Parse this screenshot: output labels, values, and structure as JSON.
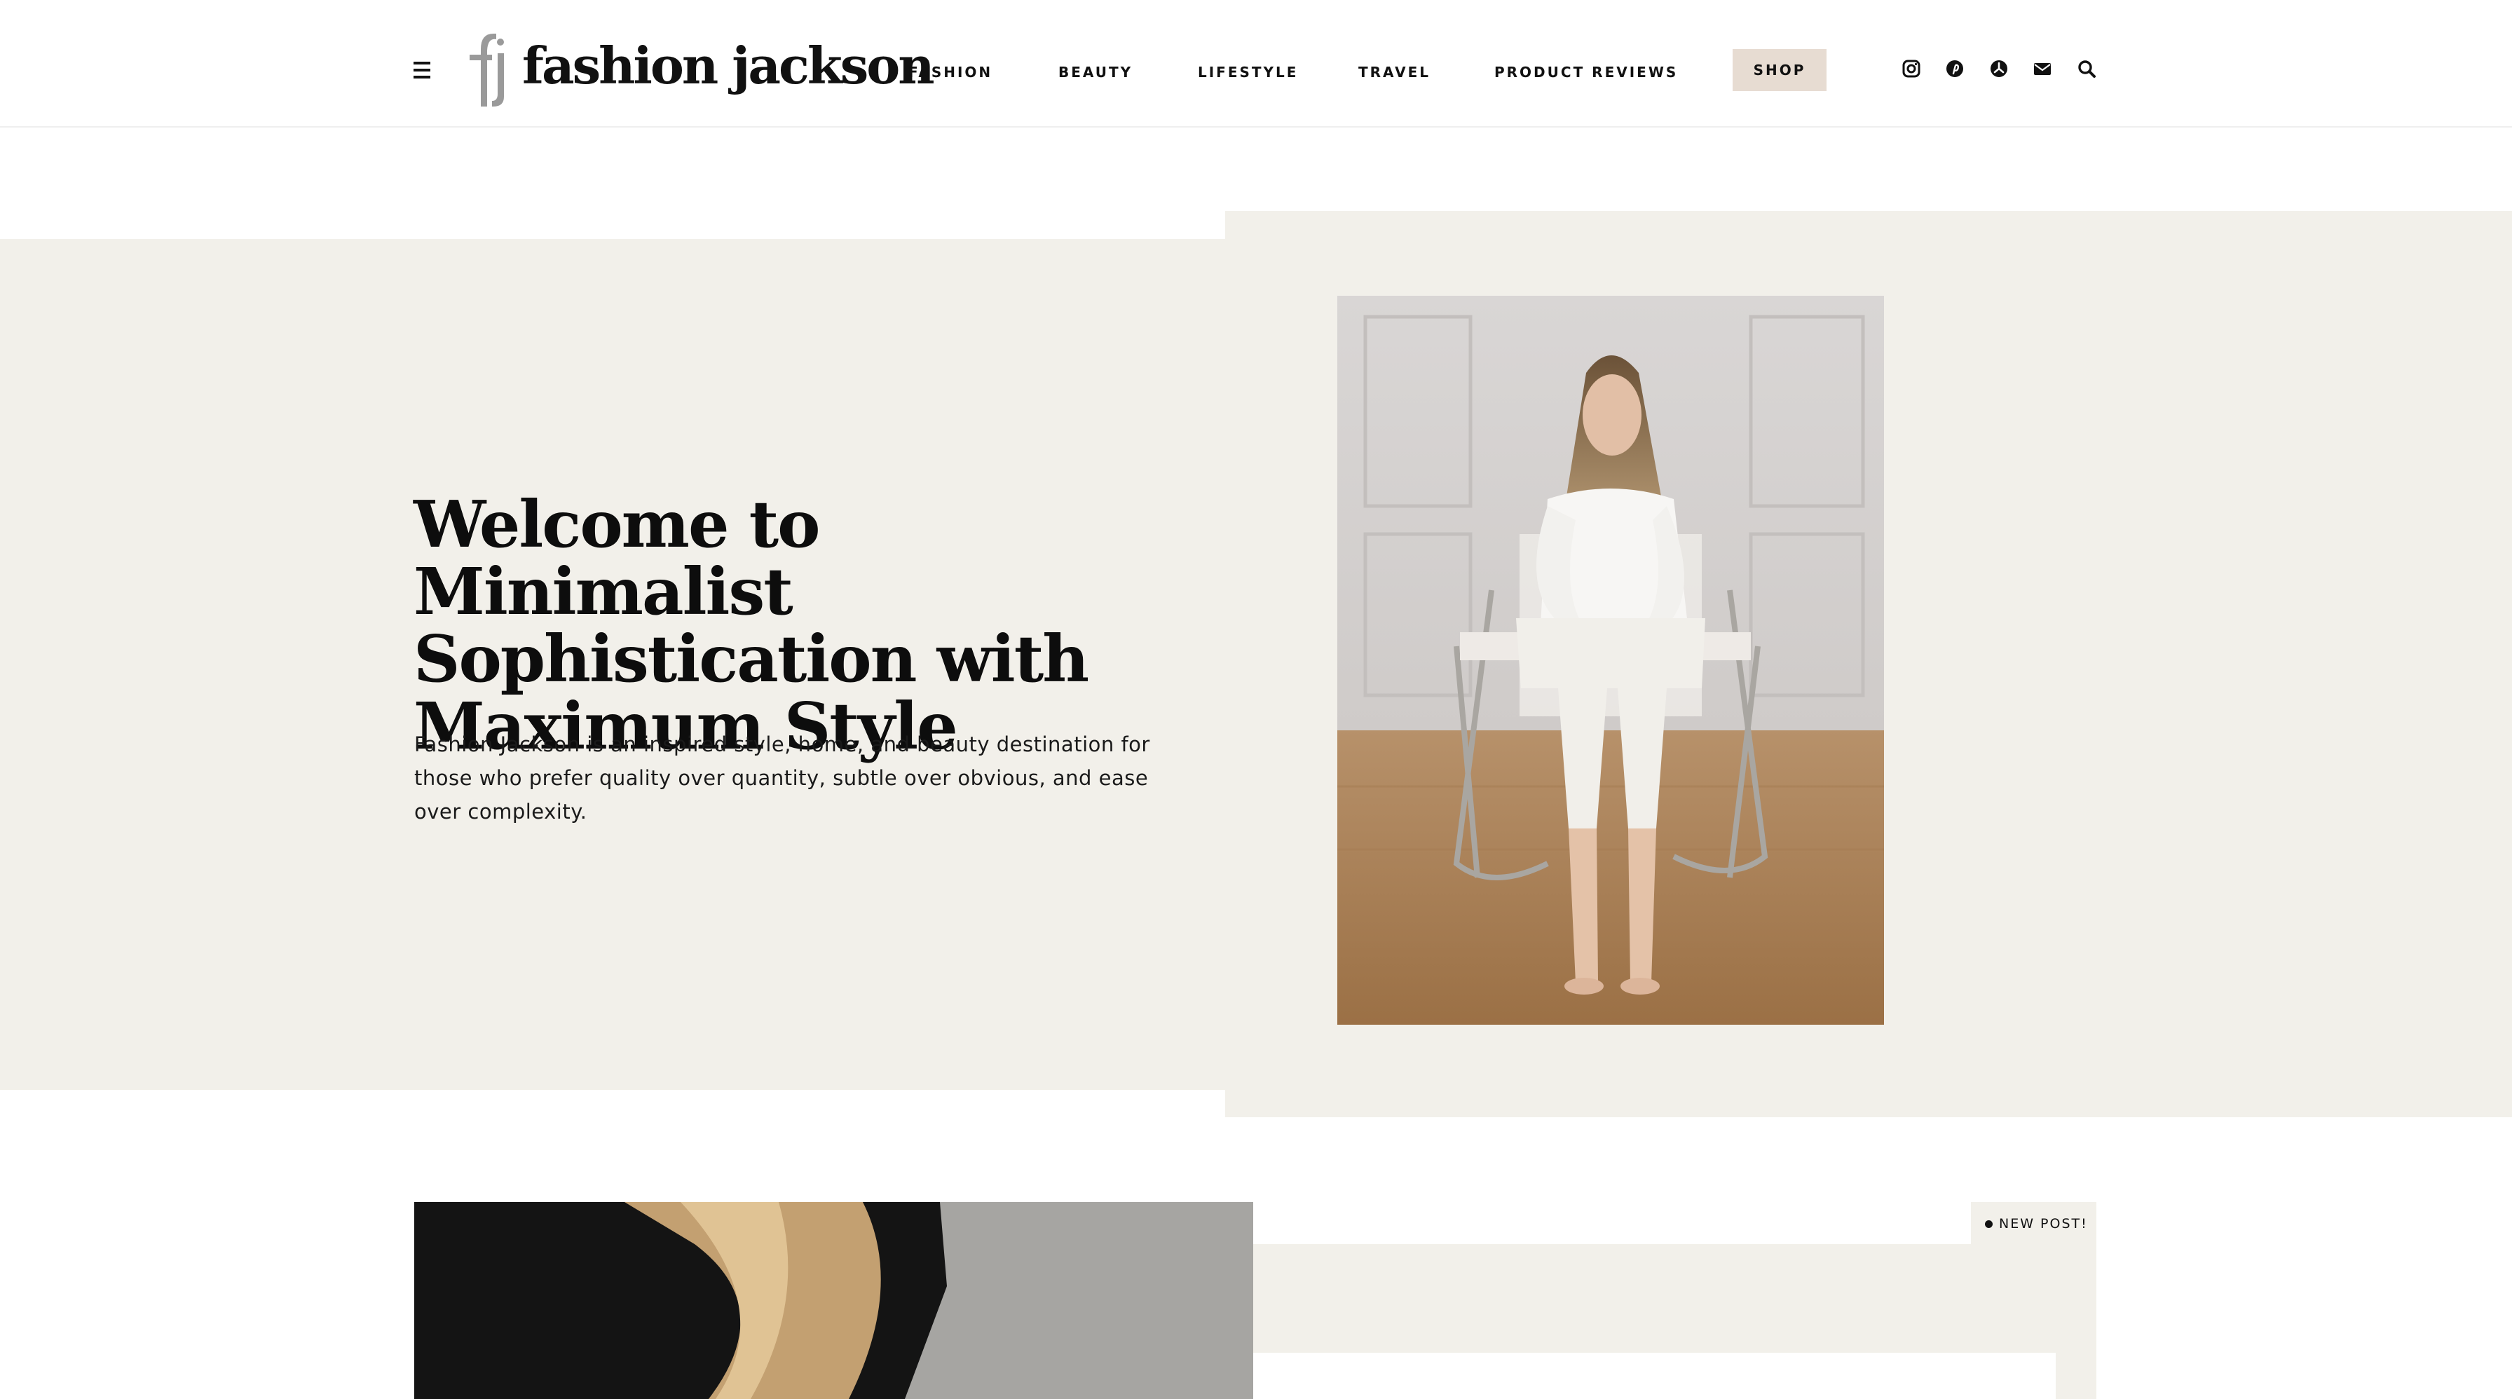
{
  "header": {
    "logo_text": "fashion jackson",
    "logo_monogram": "fj",
    "nav": [
      {
        "label": "FASHION"
      },
      {
        "label": "BEAUTY"
      },
      {
        "label": "LIFESTYLE"
      },
      {
        "label": "TRAVEL"
      },
      {
        "label": "PRODUCT REVIEWS"
      }
    ],
    "shop_label": "SHOP",
    "shop_bg": "#e7dcd2",
    "icons": [
      "menu-icon",
      "instagram-icon",
      "pinterest-icon",
      "ltk-icon",
      "email-icon",
      "search-icon"
    ]
  },
  "hero": {
    "title_lines": [
      "Welcome to Minimalist",
      "Sophistication with",
      "Maximum Style"
    ],
    "description": "Fashion Jackson is an inspired style, home, and beauty destination for those who prefer quality over quantity, subtle over obvious, and ease over complexity.",
    "background_color": "#f2f0ea"
  },
  "post": {
    "badge": "NEW POST!"
  }
}
